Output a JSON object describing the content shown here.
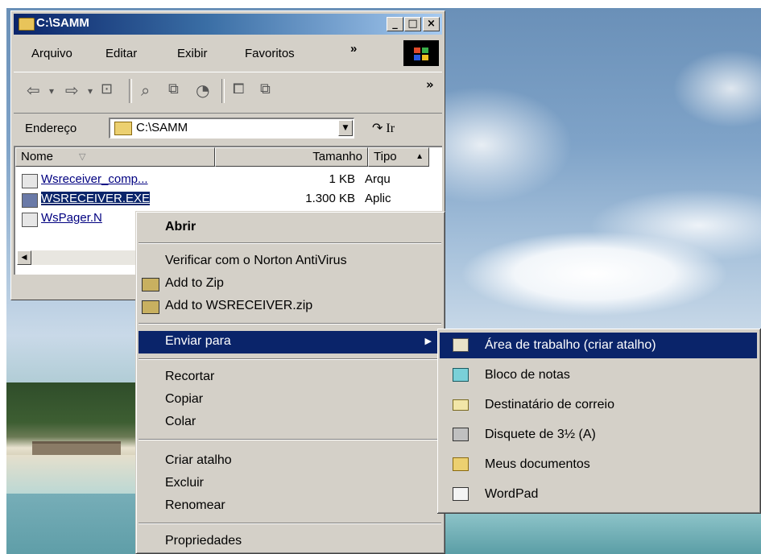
{
  "window": {
    "title": "C:\\SAMM",
    "buttons": {
      "minimize": "_",
      "maximize": "□",
      "close": "×"
    }
  },
  "menubar": {
    "items": [
      "Arquivo",
      "Editar",
      "Exibir",
      "Favoritos"
    ],
    "overflow": "»"
  },
  "toolbar": {
    "icons": [
      "back-icon",
      "forward-icon",
      "up-folder-icon",
      "search-icon",
      "folders-icon",
      "history-icon",
      "move-to-icon",
      "copy-to-icon"
    ],
    "overflow": "»"
  },
  "address": {
    "label": "Endereço",
    "value": "C:\\SAMM",
    "go": "Ir"
  },
  "list": {
    "columns": [
      "Nome",
      "Tamanho",
      "Tipo"
    ],
    "rows": [
      {
        "name": "Wsreceiver_comp...",
        "size": "1 KB",
        "type": "Arqu"
      },
      {
        "name": "WSRECEIVER.EXE",
        "size": "1.300 KB",
        "type": "Aplic"
      },
      {
        "name": "WsPager.N",
        "size": "",
        "type": ""
      }
    ]
  },
  "context_menu": {
    "open": "Abrir",
    "norton": "Verificar com o Norton AntiVirus",
    "add_zip": "Add to Zip",
    "add_named_zip": "Add to WSRECEIVER.zip",
    "send_to": "Enviar para",
    "cut": "Recortar",
    "copy": "Copiar",
    "paste": "Colar",
    "create_shortcut": "Criar atalho",
    "delete": "Excluir",
    "rename": "Renomear",
    "properties": "Propriedades"
  },
  "send_to_menu": {
    "items": [
      {
        "label": "Área de trabalho (criar atalho)",
        "icon": "desktop-shortcut-icon"
      },
      {
        "label": "Bloco de notas",
        "icon": "notepad-icon"
      },
      {
        "label": "Destinatário de correio",
        "icon": "mail-icon"
      },
      {
        "label": "Disquete de 3½ (A)",
        "icon": "floppy-icon"
      },
      {
        "label": "Meus documentos",
        "icon": "my-documents-icon"
      },
      {
        "label": "WordPad",
        "icon": "wordpad-icon"
      }
    ]
  },
  "colors": {
    "highlight": "#0a246a",
    "face": "#d4d0c8"
  }
}
